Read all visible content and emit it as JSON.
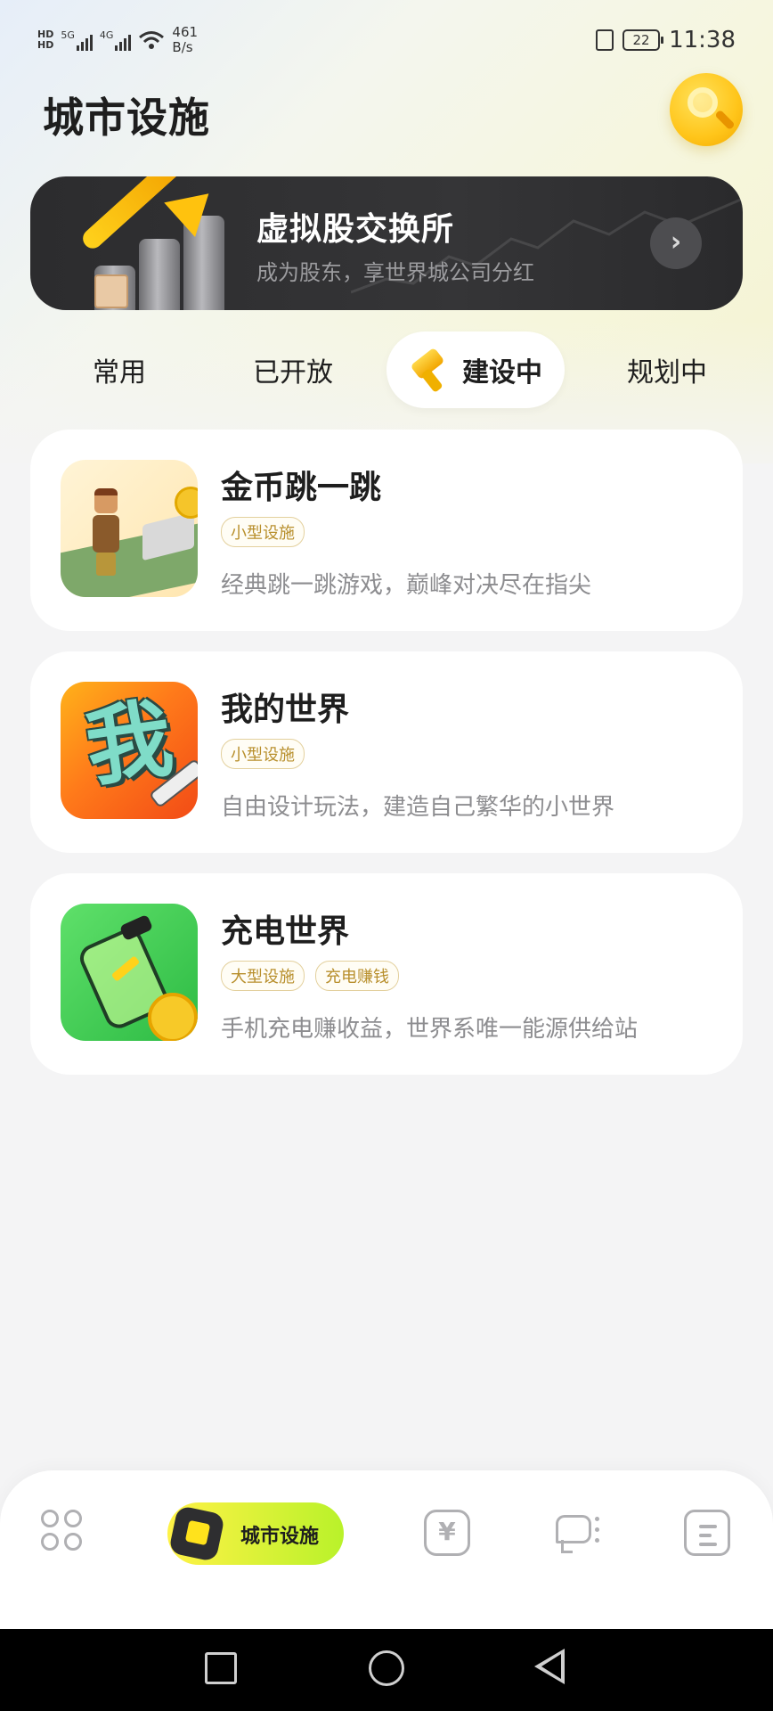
{
  "status_bar": {
    "hd1": "HD",
    "hd2": "HD",
    "sig1": "5G",
    "sig2": "4G",
    "net_speed": "461",
    "net_unit": "B/s",
    "battery": "22",
    "time": "11:38"
  },
  "header": {
    "title": "城市设施"
  },
  "banner": {
    "title": "虚拟股交换所",
    "subtitle": "成为股东，享世界城公司分红",
    "arrow": "›"
  },
  "tabs": [
    {
      "label": "常用",
      "active": false
    },
    {
      "label": "已开放",
      "active": false
    },
    {
      "label": "建设中",
      "active": true
    },
    {
      "label": "规划中",
      "active": false
    }
  ],
  "cards": [
    {
      "title": "金币跳一跳",
      "tags": [
        "小型设施"
      ],
      "description": "经典跳一跳游戏，巅峰对决尽在指尖"
    },
    {
      "title": "我的世界",
      "tags": [
        "小型设施"
      ],
      "description": "自由设计玩法，建造自己繁华的小世界",
      "icon_glyph": "我"
    },
    {
      "title": "充电世界",
      "tags": [
        "大型设施",
        "充电赚钱"
      ],
      "description": "手机充电赚收益，世界系唯一能源供给站"
    }
  ],
  "bottom_nav": {
    "active_label": "城市设施",
    "yuan_symbol": "¥",
    "items": [
      "grid-icon",
      "city-facility-icon",
      "yuan-icon",
      "megaphone-icon",
      "news-icon"
    ]
  },
  "colors": {
    "accent_yellow": "#ffc51a",
    "tag_text": "#b88f2c",
    "banner_bg": "#2c2c2e"
  }
}
